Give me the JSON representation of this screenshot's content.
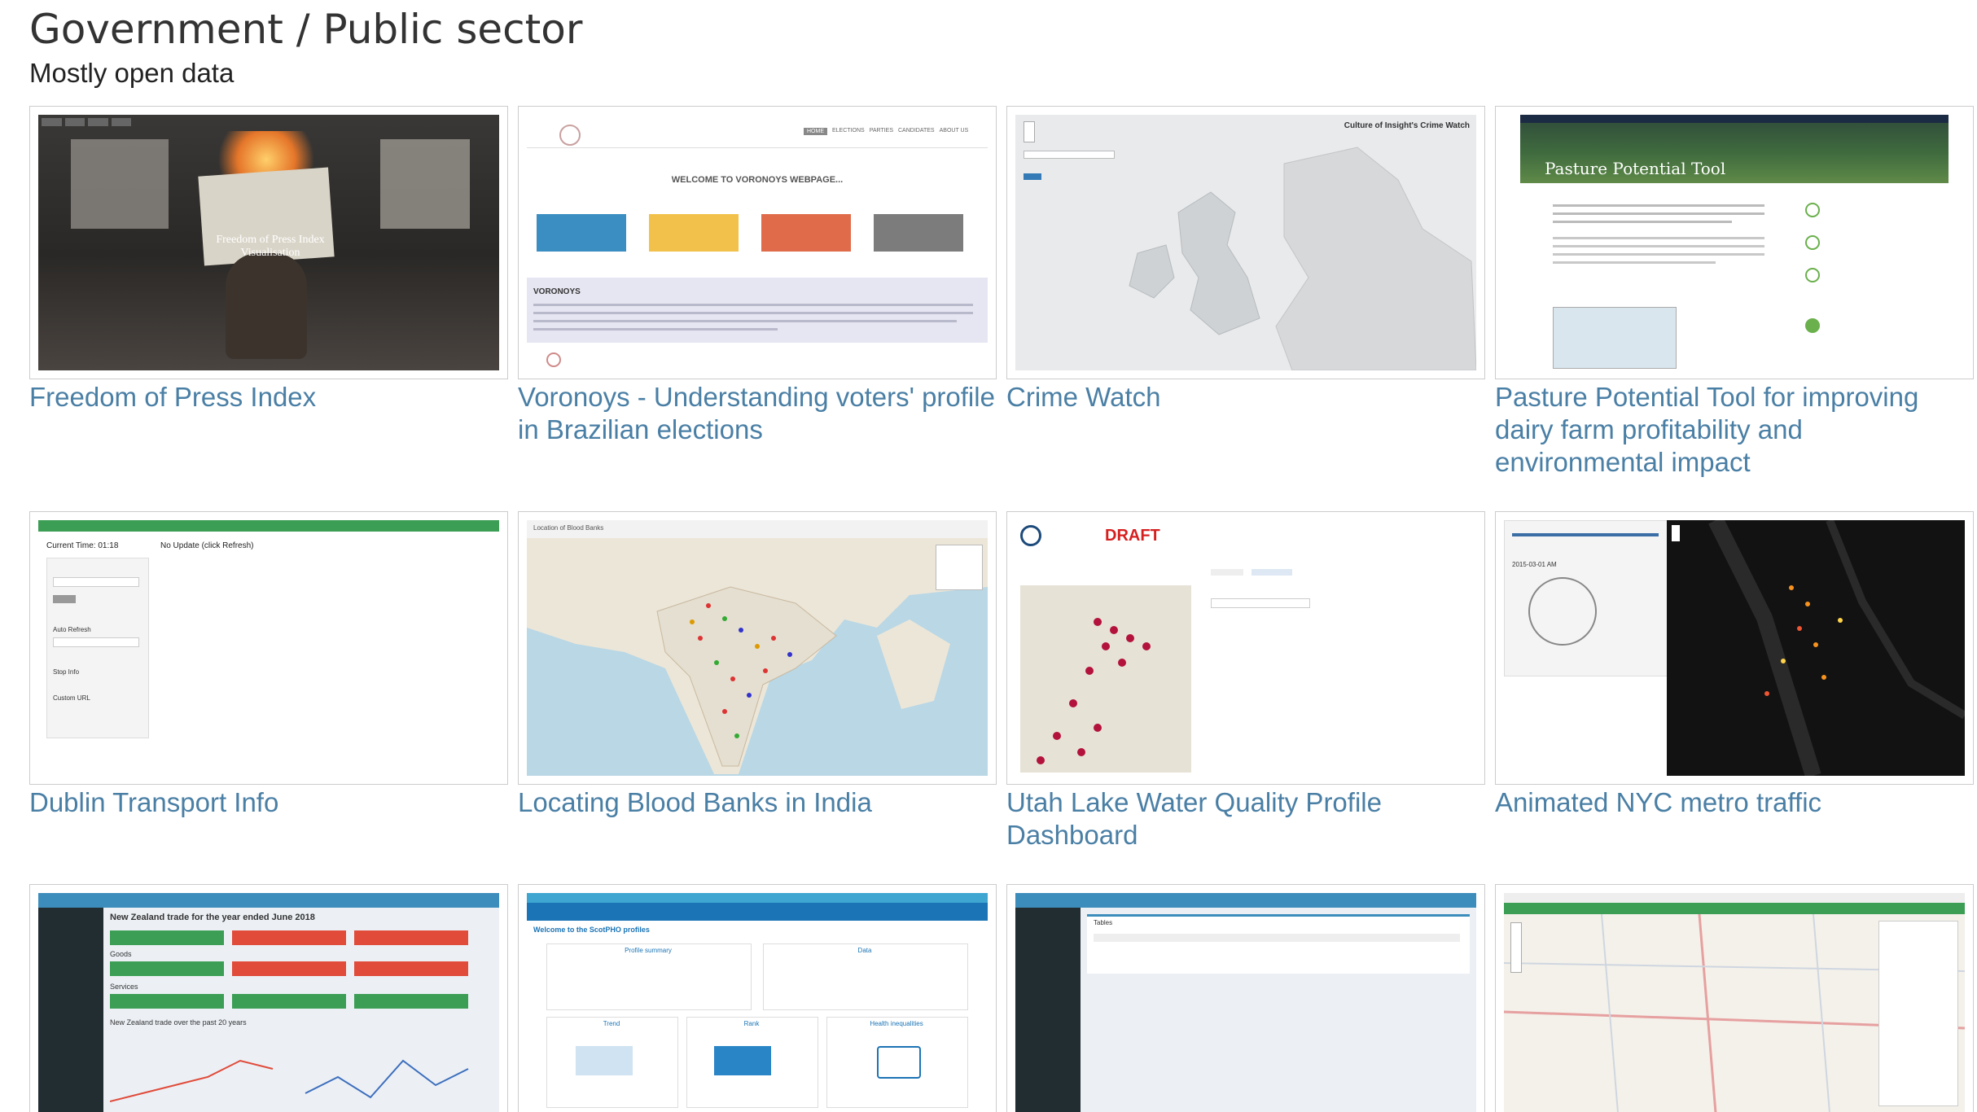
{
  "header": {
    "title": "Government / Public sector",
    "subtitle": "Mostly open data"
  },
  "cards": [
    {
      "caption": "Freedom of Press Index",
      "overlay": "Freedom of Press Index Visualisation"
    },
    {
      "caption": "Voronoys - Understanding voters' profile in Brazilian elections",
      "overlay": "WELCOME TO VORONOYS WEBPAGE...",
      "section": "VORONOYS",
      "nav": [
        "HOME",
        "ELECTIONS",
        "PARTIES",
        "CANDIDATES",
        "ABOUT US"
      ]
    },
    {
      "caption": "Crime Watch",
      "overlay": "Culture of Insight's Crime Watch"
    },
    {
      "caption": "Pasture Potential Tool for improving dairy farm profitability and environmental impact",
      "overlay": "Pasture Potential Tool"
    },
    {
      "caption": "Dublin Transport Info",
      "overlay": "Current Time: 01:18",
      "note": "No Update (click Refresh)",
      "labels": [
        "Auto Refresh",
        "Stop Info",
        "Custom URL"
      ]
    },
    {
      "caption": "Locating Blood Banks in India",
      "overlay": "Location of Blood Banks"
    },
    {
      "caption": "Utah Lake Water Quality Profile Dashboard",
      "overlay": "DRAFT"
    },
    {
      "caption": "Animated NYC metro traffic",
      "overlay": "2015-03-01 AM"
    },
    {
      "caption": "",
      "overlay": "New Zealand trade for the year ended June 2018",
      "labels": [
        "Goods",
        "Services",
        "New Zealand trade over the past 20 years"
      ]
    },
    {
      "caption": "",
      "overlay": "Welcome to the ScotPHO profiles",
      "labels": [
        "Profile summary",
        "Data",
        "Trend",
        "Rank",
        "Health inequalities"
      ]
    },
    {
      "caption": "",
      "overlay": "Tables"
    },
    {
      "caption": "",
      "overlay": ""
    }
  ],
  "colors": {
    "link": "#4a7fa5",
    "blue_tile": "#3b8ec2",
    "yellow_tile": "#f2c14b",
    "red_tile": "#e06b4a",
    "gray_tile": "#7c7c7c",
    "green": "#3c9e55",
    "draft_red": "#d62020",
    "crimson_dot": "#b3123d"
  },
  "icons": {
    "map_marker": "map-marker-icon",
    "zoom_in": "zoom-in-icon",
    "zoom_out": "zoom-out-icon",
    "clock": "clock-icon"
  }
}
